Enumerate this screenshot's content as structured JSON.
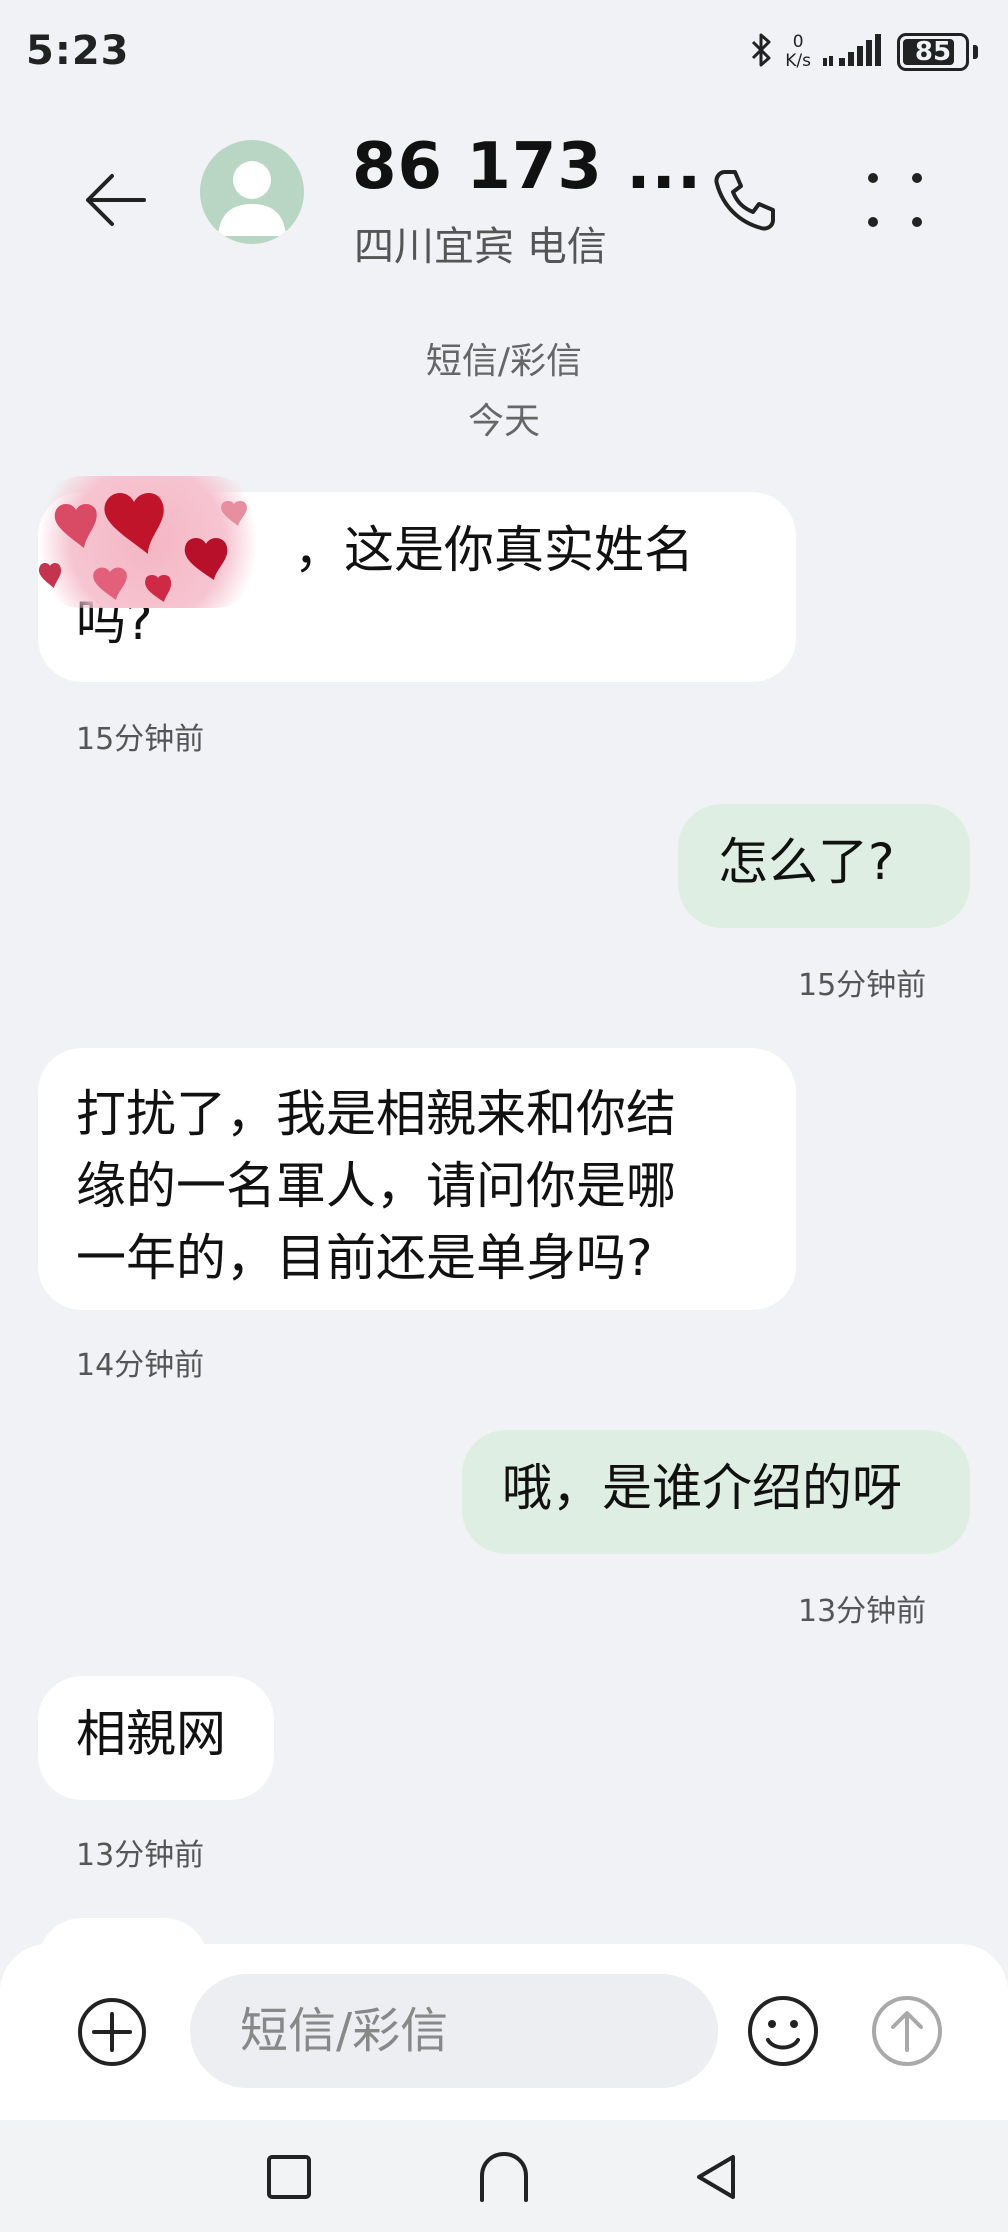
{
  "status_bar": {
    "time": "5:23",
    "net_speed_value": "0",
    "net_speed_unit": "K/s",
    "battery_level": 85,
    "battery_label": "85",
    "icons": [
      "bluetooth-icon",
      "signal-icon",
      "battery-icon"
    ]
  },
  "header": {
    "contact_name": "86 173 ...",
    "contact_location": "四川宜宾 电信",
    "icons": [
      "back-arrow-icon",
      "avatar-icon",
      "phone-icon",
      "more-icon"
    ]
  },
  "thread": {
    "type_label": "短信/彩信",
    "date_label": "今天"
  },
  "messages": [
    {
      "direction": "incoming",
      "text_line1": "，这是你真实姓名",
      "text_line2": "吗?",
      "time": "15分钟前",
      "has_sticker": true
    },
    {
      "direction": "outgoing",
      "text": "怎么了?",
      "time": "15分钟前"
    },
    {
      "direction": "incoming",
      "text_line1": "打扰了，我是相親来和你结",
      "text_line2": "缘的一名軍人，请问你是哪",
      "text_line3": "一年的，目前还是单身吗?",
      "time": "14分钟前"
    },
    {
      "direction": "outgoing",
      "text": "哦，是谁介绍的呀",
      "time": "13分钟前"
    },
    {
      "direction": "incoming",
      "text": "相親网",
      "time": "13分钟前"
    }
  ],
  "composer": {
    "placeholder": "短信/彩信",
    "icons": [
      "add-icon",
      "emoji-icon",
      "send-icon"
    ]
  },
  "nav_bar": {
    "icons": [
      "recents-square-icon",
      "home-icon",
      "back-triangle-icon"
    ]
  },
  "colors": {
    "background": "#f0f2f5",
    "incoming_bubble": "#ffffff",
    "outgoing_bubble": "#dfeee3",
    "avatar_bg": "#b8d6c3"
  }
}
